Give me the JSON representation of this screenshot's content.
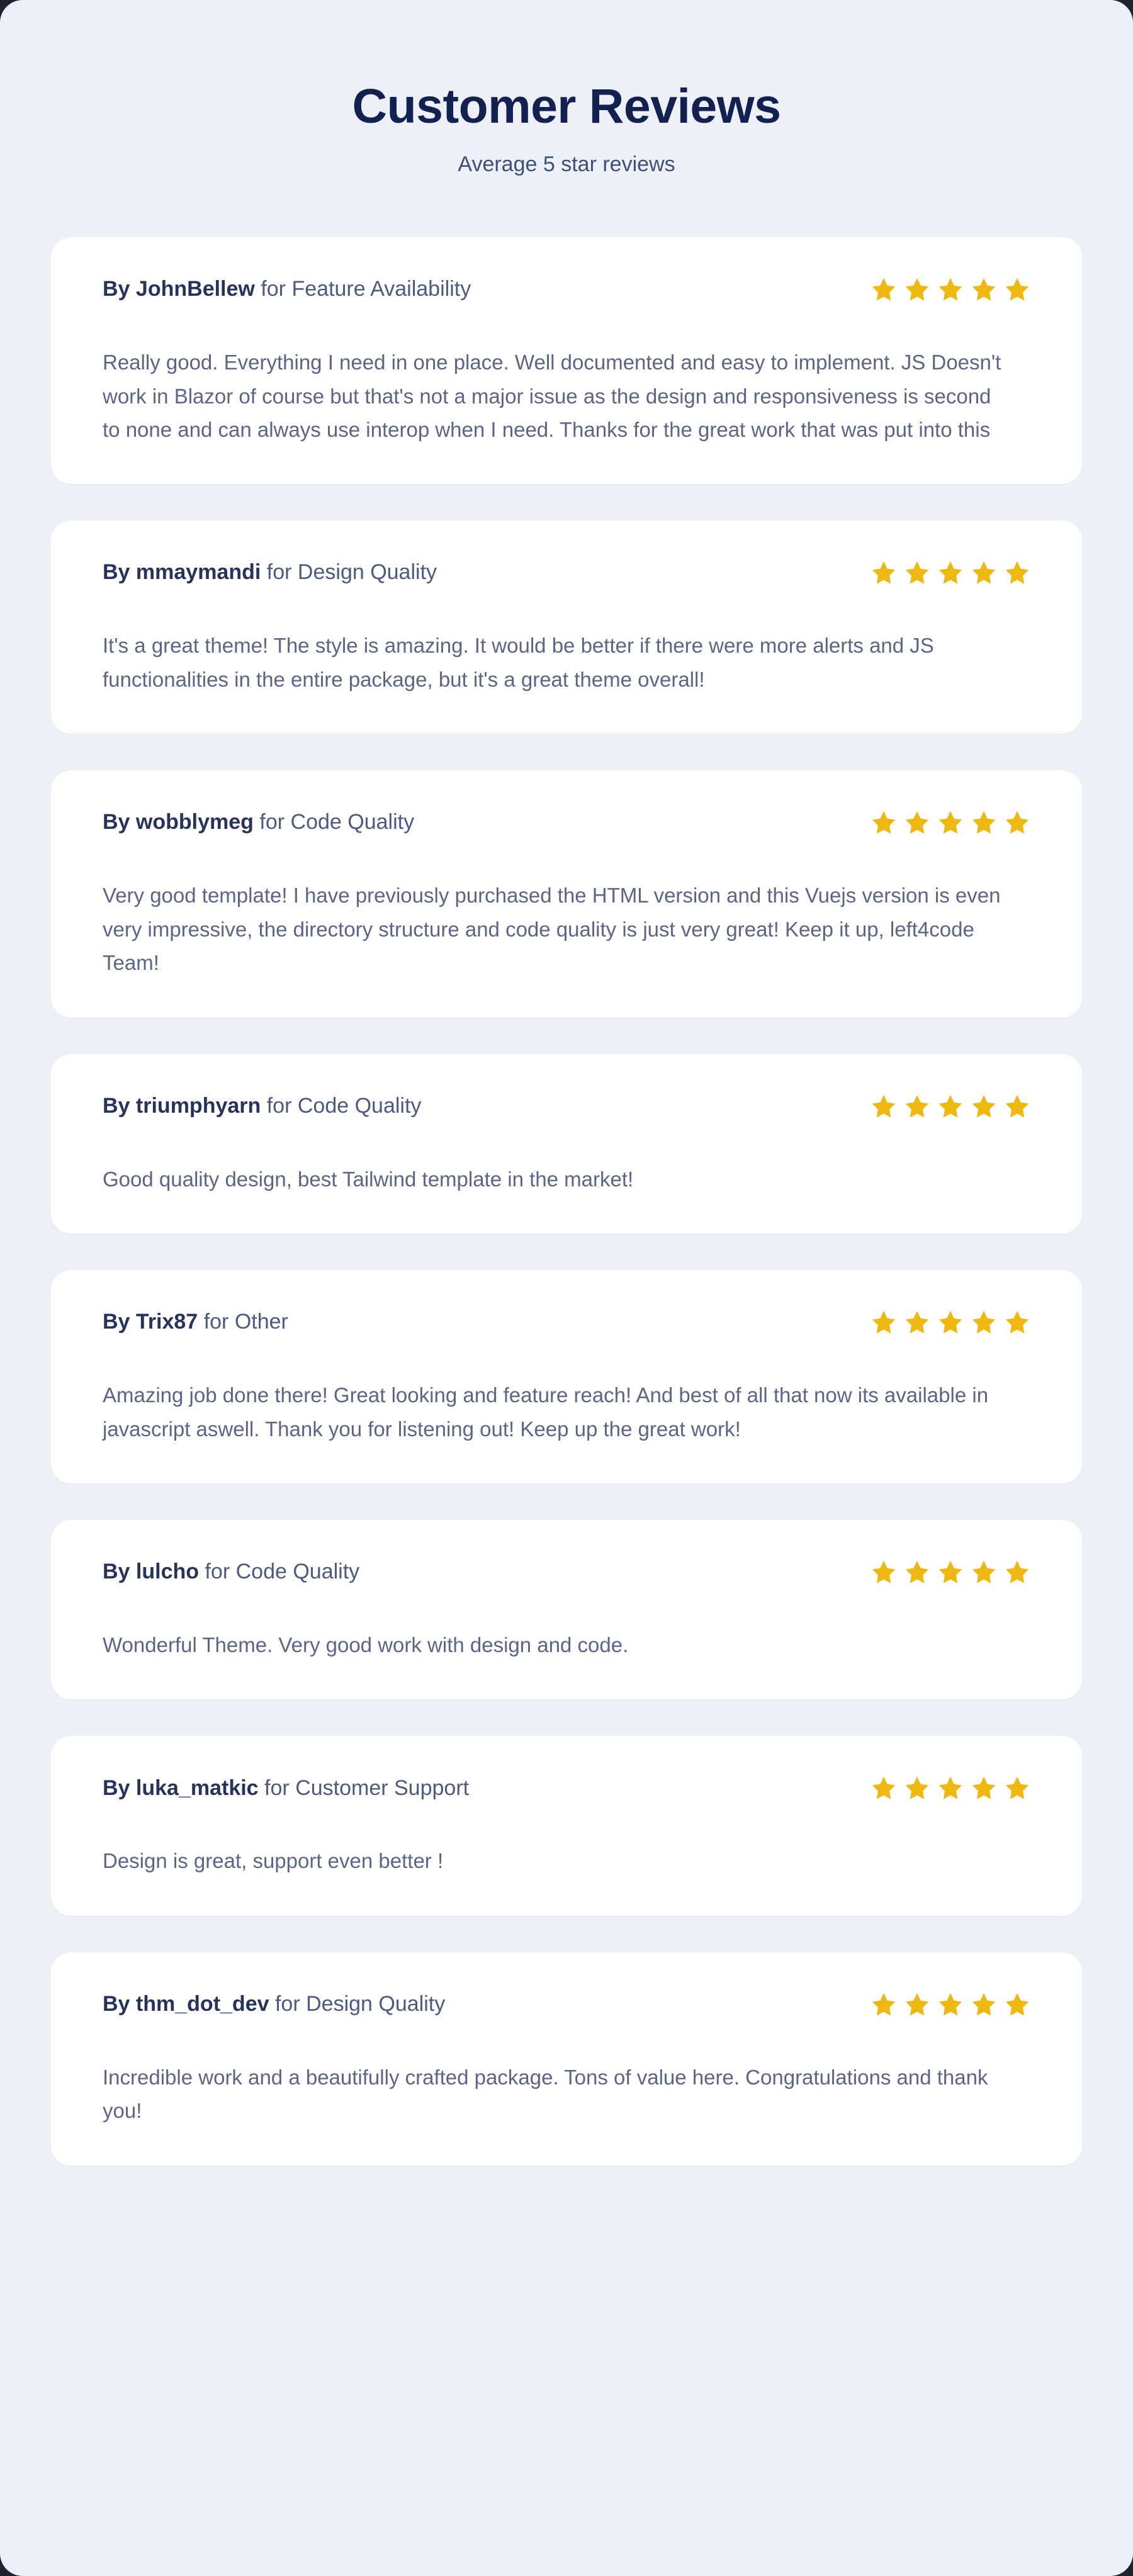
{
  "header": {
    "title": "Customer Reviews",
    "subtitle": "Average 5 star reviews"
  },
  "labels": {
    "by_prefix": "By",
    "for_connector": "for",
    "star_icon": "star-icon"
  },
  "colors": {
    "page_background": "#edf0f7",
    "card_background": "#ffffff",
    "title": "#122150",
    "subtitle": "#3f4f7a",
    "author": "#27335a",
    "category": "#4c5a80",
    "body_text": "#5b6585",
    "star": "#efb810"
  },
  "reviews": [
    {
      "author": "JohnBellew",
      "category": "Feature Availability",
      "rating": 5,
      "text": "Really good. Everything I need in one place. Well documented and easy to implement. JS Doesn't work in Blazor of course but that's not a major issue as the design and responsiveness is second to none and can always use interop when I need. Thanks for the great work that was put into this"
    },
    {
      "author": "mmaymandi",
      "category": "Design Quality",
      "rating": 5,
      "text": "It's a great theme! The style is amazing. It would be better if there were more alerts and JS functionalities in the entire package, but it's a great theme overall!"
    },
    {
      "author": "wobblymeg",
      "category": "Code Quality",
      "rating": 5,
      "text": "Very good template! I have previously purchased the HTML version and this Vuejs version is even very impressive, the directory structure and code quality is just very great! Keep it up, left4code Team!"
    },
    {
      "author": "triumphyarn",
      "category": "Code Quality",
      "rating": 5,
      "text": "Good quality design, best Tailwind template in the market!"
    },
    {
      "author": "Trix87",
      "category": "Other",
      "rating": 5,
      "text": "Amazing job done there! Great looking and feature reach! And best of all that now its available in javascript aswell. Thank you for listening out! Keep up the great work!"
    },
    {
      "author": "lulcho",
      "category": "Code Quality",
      "rating": 5,
      "text": "Wonderful Theme. Very good work with design and code."
    },
    {
      "author": "luka_matkic",
      "category": "Customer Support",
      "rating": 5,
      "text": "Design is great, support even better !"
    },
    {
      "author": "thm_dot_dev",
      "category": "Design Quality",
      "rating": 5,
      "text": "Incredible work and a beautifully crafted package. Tons of value here. Congratulations and thank you!"
    }
  ]
}
